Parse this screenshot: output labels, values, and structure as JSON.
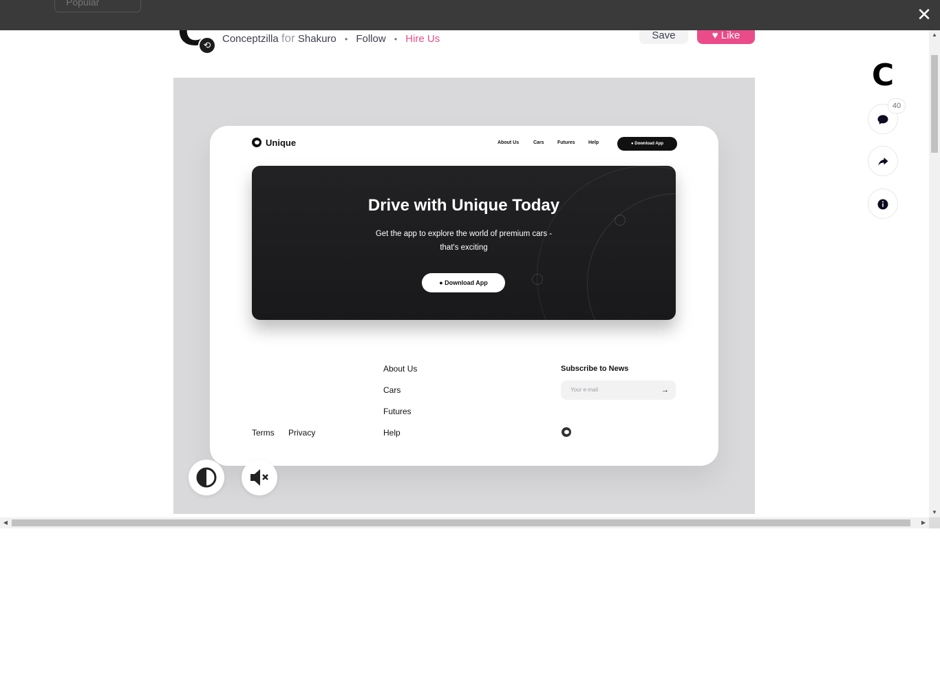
{
  "topbar": {
    "behind_label": "Popular",
    "close_label": "✕"
  },
  "header": {
    "author": "Conceptzilla",
    "for_label": "for",
    "team": "Shakuro",
    "follow_label": "Follow",
    "hire_label": "Hire Us",
    "save_label": "Save",
    "like_label": "♥ Like"
  },
  "side": {
    "comment_count": "40",
    "icons": [
      "comment-icon",
      "share-icon",
      "info-icon"
    ]
  },
  "shot": {
    "brand": "Unique",
    "nav": [
      "About Us",
      "Cars",
      "Futures",
      "Help"
    ],
    "nav_download": "Download App",
    "hero_title": "Drive with Unique Today",
    "hero_sub": "Get the app to explore the world of premium cars - that's exciting",
    "hero_button": "Download App",
    "footer_links": [
      "About Us",
      "Cars",
      "Futures",
      "Help"
    ],
    "legal": [
      "Terms",
      "Privacy"
    ],
    "subscribe_title": "Subscribe to News",
    "email_placeholder": "Your e-mail"
  },
  "controls": [
    "contrast-icon",
    "mute-icon"
  ],
  "colors": {
    "accent": "#ea4c89",
    "topbar": "#3a3a3a",
    "shot_bg": "#d9d9db"
  }
}
